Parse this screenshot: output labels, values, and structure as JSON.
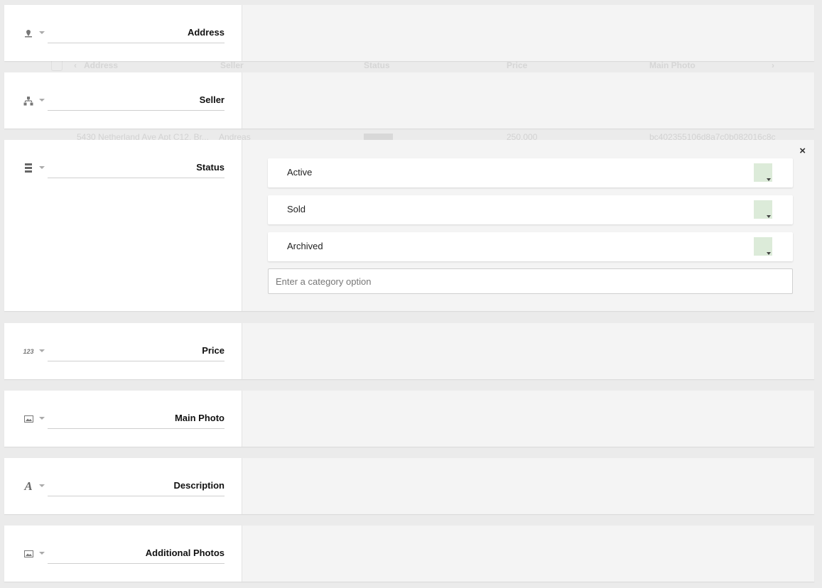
{
  "background_table": {
    "columns": [
      "Address",
      "Seller",
      "Status",
      "Price",
      "Main Photo"
    ],
    "row": {
      "address": "5430 Netherland Ave Apt C12, Br...",
      "seller": "Andreas",
      "status": "Active",
      "price": "250,000",
      "photo": "bc402355106d8a7c0b082016c8c"
    }
  },
  "fields": [
    {
      "name": "Address",
      "icon": "location-pin-icon"
    },
    {
      "name": "Seller",
      "icon": "hierarchy-icon"
    },
    {
      "name": "Status",
      "icon": "list-icon",
      "expanded": true,
      "options": [
        {
          "label": "Active",
          "color": "#dcebd9"
        },
        {
          "label": "Sold",
          "color": "#dcebd9"
        },
        {
          "label": "Archived",
          "color": "#dcebd9"
        }
      ],
      "new_option_placeholder": "Enter a category option",
      "close_label": "×"
    },
    {
      "name": "Price",
      "icon": "number-123-icon"
    },
    {
      "name": "Main Photo",
      "icon": "image-icon"
    },
    {
      "name": "Description",
      "icon": "text-a-icon"
    },
    {
      "name": "Additional Photos",
      "icon": "image-icon"
    }
  ]
}
